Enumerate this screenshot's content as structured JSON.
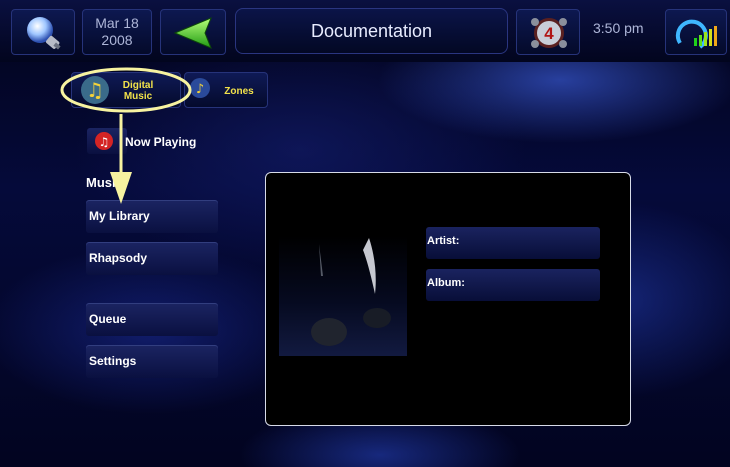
{
  "header": {
    "date_line1": "Mar 18",
    "date_line2": "2008",
    "title": "Documentation",
    "time": "3:50 pm",
    "badge_number": "4"
  },
  "tabs": [
    {
      "label_line1": "Digital",
      "label_line2": "Music",
      "selected": true
    },
    {
      "label_line1": "Zones",
      "label_line2": "",
      "selected": false
    }
  ],
  "now_playing": {
    "label": "Now Playing"
  },
  "music_section": {
    "heading": "Music"
  },
  "menu": [
    {
      "label": "My Library"
    },
    {
      "label": "Rhapsody"
    },
    {
      "label": "Queue"
    },
    {
      "label": "Settings"
    }
  ],
  "track_info": {
    "artist_label": "Artist:",
    "album_label": "Album:"
  },
  "colors": {
    "highlight": "#f7f3a0",
    "tab_text": "#f2e24a",
    "accent_green": "#2ec81e"
  },
  "icons": [
    "lightbulb-icon",
    "back-arrow-icon",
    "security-badge-icon",
    "signal-strength-icon",
    "music-notes-icon",
    "zones-icon",
    "now-playing-icon",
    "album-art-placeholder"
  ]
}
